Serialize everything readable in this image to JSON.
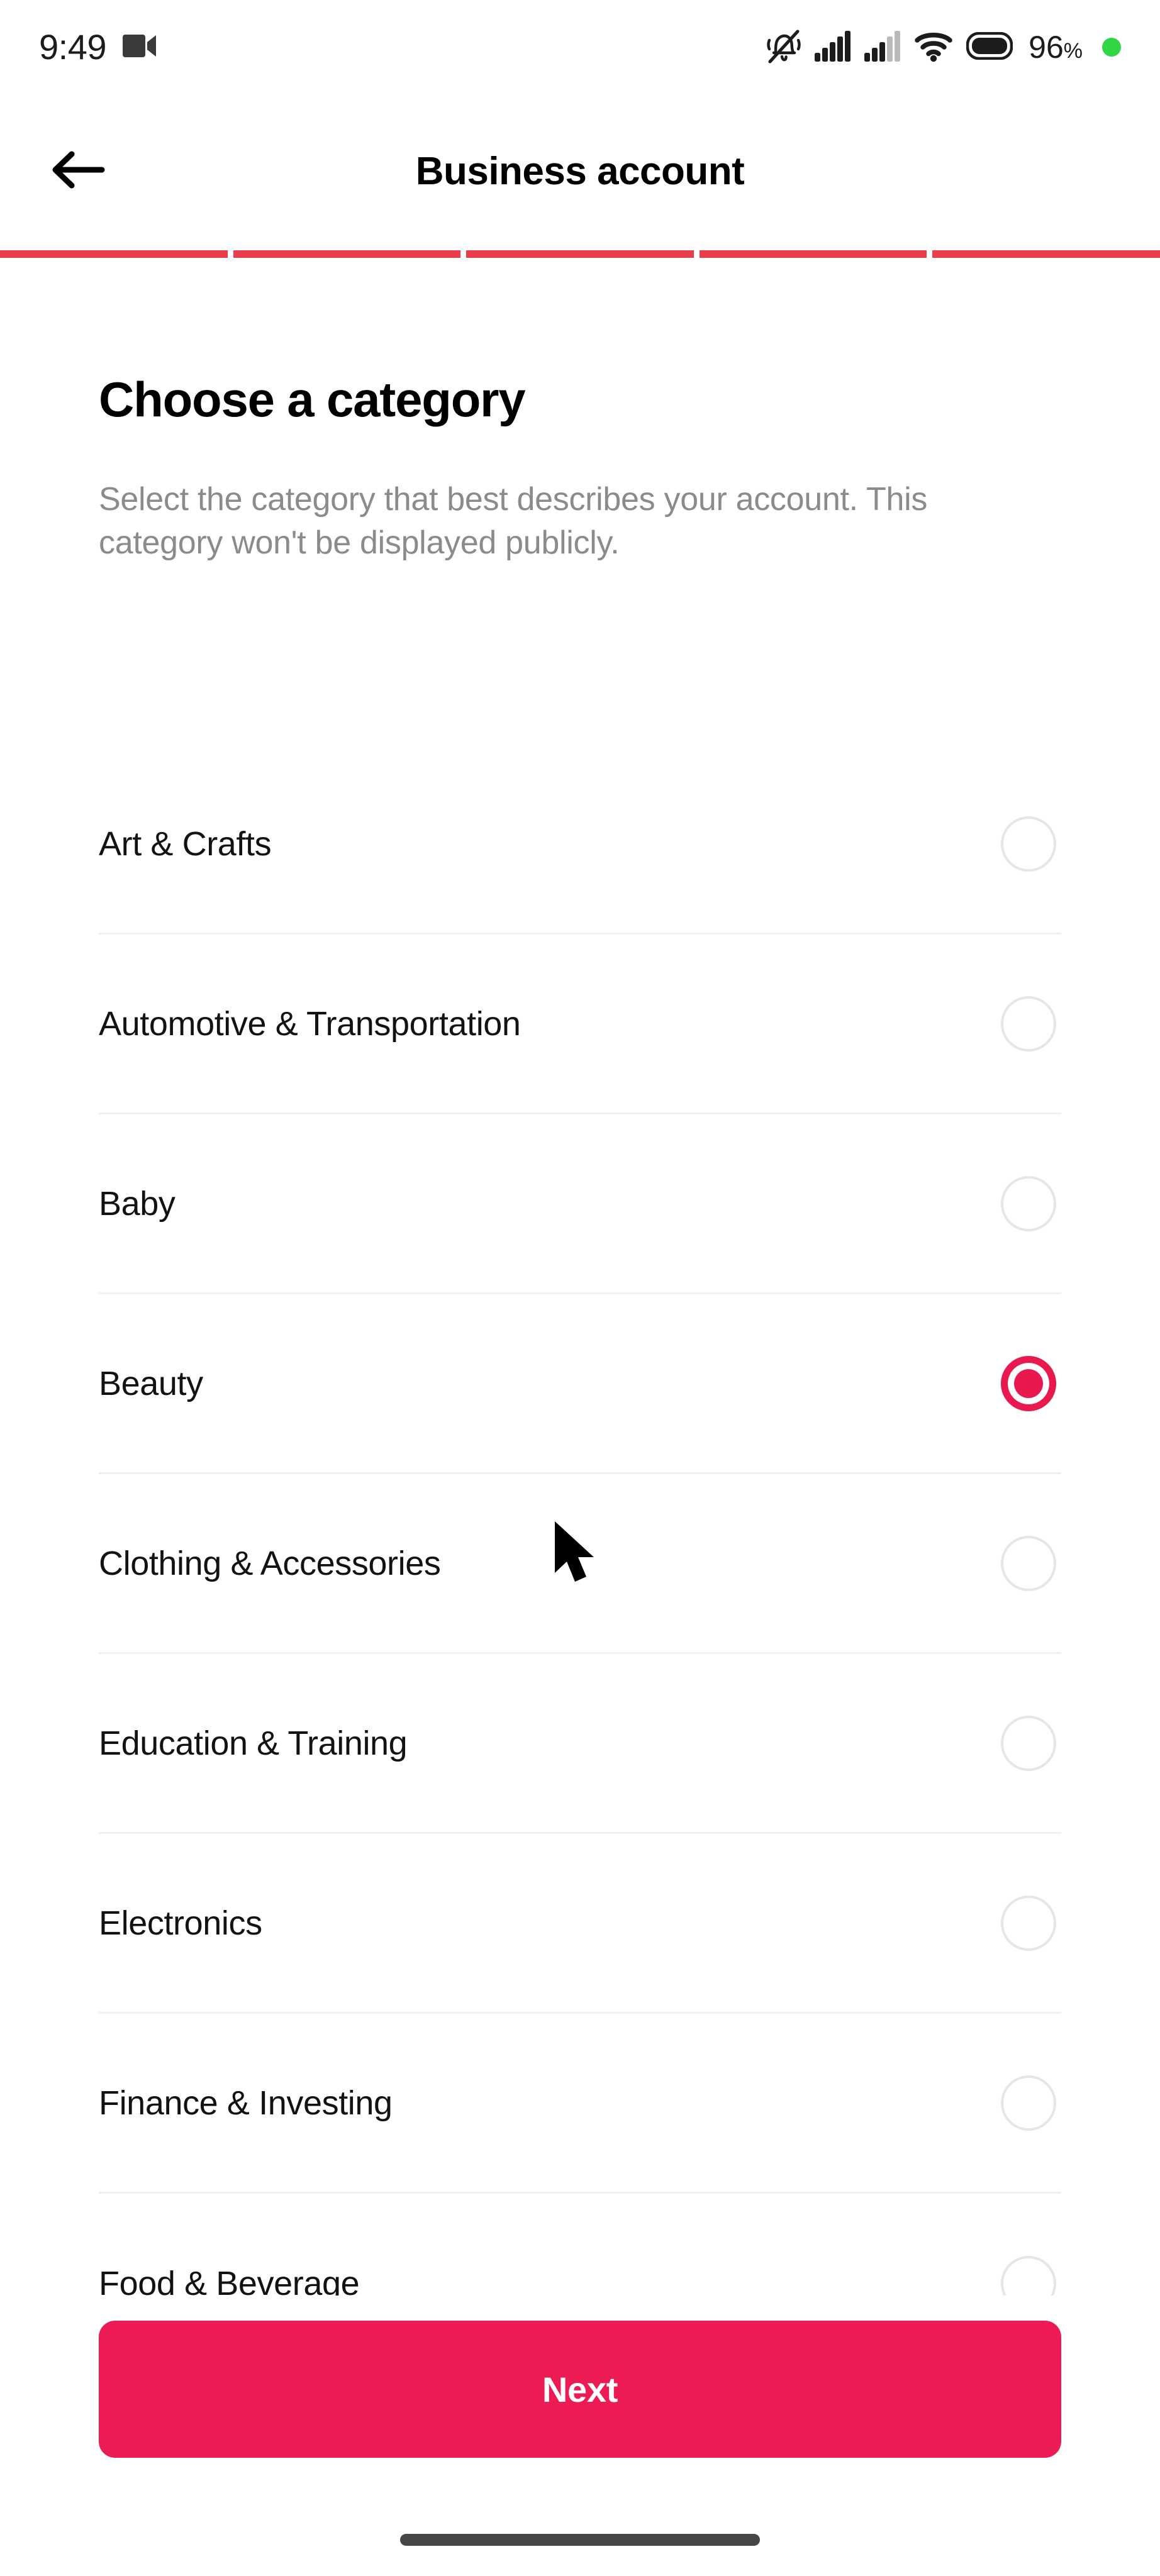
{
  "status_bar": {
    "time": "9:49",
    "battery_percent": "96",
    "percent_sign": "%",
    "icons": [
      "video-camera-icon",
      "bell-muted-icon",
      "cellular-signal-1-icon",
      "cellular-signal-2-icon",
      "wifi-icon",
      "battery-icon",
      "recording-dot-icon"
    ]
  },
  "header": {
    "title": "Business account",
    "back_icon": "back-arrow-icon"
  },
  "progress": {
    "total_steps": 5,
    "completed_steps": 5,
    "color": "#ea3f4a"
  },
  "main": {
    "title": "Choose a category",
    "description": "Select the category that best describes your account. This category won't be displayed publicly.",
    "categories": [
      {
        "label": "Art & Crafts",
        "selected": false
      },
      {
        "label": "Automotive & Transportation",
        "selected": false
      },
      {
        "label": "Baby",
        "selected": false
      },
      {
        "label": "Beauty",
        "selected": true
      },
      {
        "label": "Clothing & Accessories",
        "selected": false
      },
      {
        "label": "Education & Training",
        "selected": false
      },
      {
        "label": "Electronics",
        "selected": false
      },
      {
        "label": "Finance & Investing",
        "selected": false
      },
      {
        "label": "Food & Beverage",
        "selected": false
      }
    ],
    "selected_category": "Beauty"
  },
  "footer": {
    "next_label": "Next",
    "next_color": "#ed1b53"
  },
  "theme": {
    "accent": "#ed1b53",
    "selected_radio": "#e8194f",
    "progress_bar": "#ea3f4a",
    "text_primary": "#121212",
    "text_secondary": "#8b8b8b",
    "divider": "#f0f0f0",
    "background": "#ffffff"
  }
}
